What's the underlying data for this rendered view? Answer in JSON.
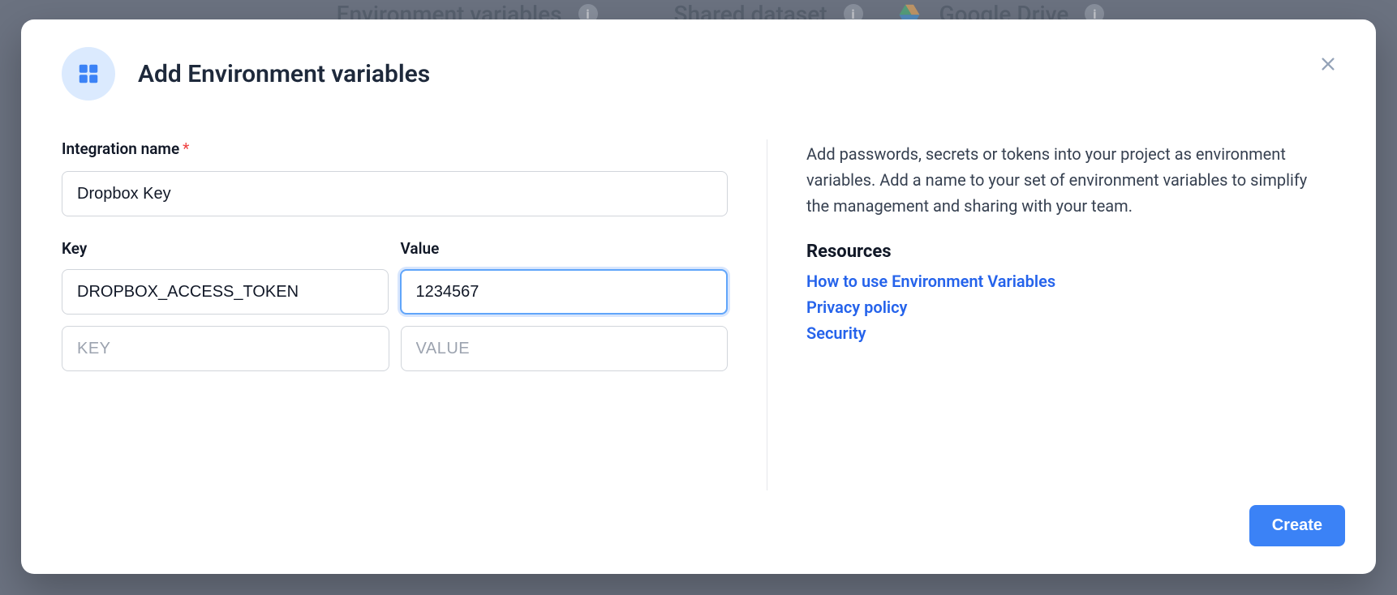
{
  "backdrop": {
    "items": [
      {
        "label": "Environment variables"
      },
      {
        "label": "Shared dataset"
      },
      {
        "label": "Google Drive"
      }
    ]
  },
  "modal": {
    "title": "Add Environment variables",
    "form": {
      "name_label": "Integration name",
      "name_value": "Dropbox Key",
      "key_label": "Key",
      "value_label": "Value",
      "rows": [
        {
          "key": "DROPBOX_ACCESS_TOKEN",
          "value": "1234567"
        },
        {
          "key": "",
          "value": ""
        }
      ],
      "key_placeholder": "KEY",
      "value_placeholder": "VALUE"
    },
    "info": {
      "description": "Add passwords, secrets or tokens into your project as environment variables. Add a name to your set of environment variables to simplify the management and sharing with your team.",
      "resources_heading": "Resources",
      "links": [
        "How to use Environment Variables",
        "Privacy policy",
        "Security"
      ]
    },
    "footer": {
      "create_label": "Create"
    }
  }
}
